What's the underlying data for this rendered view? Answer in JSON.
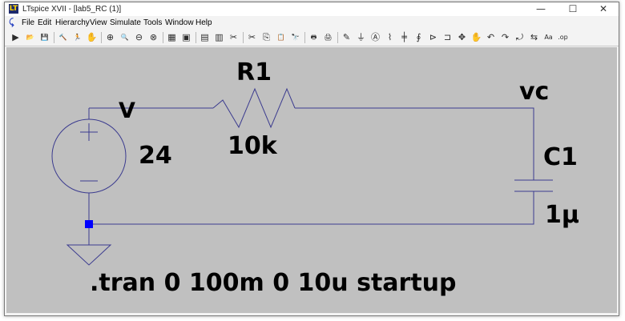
{
  "window": {
    "title": "LTspice XVII - [lab5_RC (1)]",
    "app_icon": "LT",
    "controls": {
      "minimize": "—",
      "maximize": "☐",
      "close": "✕"
    }
  },
  "menu": {
    "icon": "ltspice-arrow-icon",
    "items": [
      {
        "label": "File"
      },
      {
        "label": "Edit"
      },
      {
        "label": "Hierarchy"
      },
      {
        "label": "View"
      },
      {
        "label": "Simulate"
      },
      {
        "label": "Tools"
      },
      {
        "label": "Window"
      },
      {
        "label": "Help"
      }
    ]
  },
  "toolbar": {
    "groups": [
      [
        {
          "name": "run-icon",
          "glyph": "▶"
        },
        {
          "name": "open-icon",
          "glyph": "📂"
        },
        {
          "name": "save-icon",
          "glyph": "💾"
        }
      ],
      [
        {
          "name": "control-panel-icon",
          "glyph": "🔨"
        },
        {
          "name": "run-man-icon",
          "glyph": "🏃"
        },
        {
          "name": "halt-icon",
          "glyph": "✋"
        }
      ],
      [
        {
          "name": "zoom-in-icon",
          "glyph": "⊕"
        },
        {
          "name": "pan-icon",
          "glyph": "🔍"
        },
        {
          "name": "zoom-out-icon",
          "glyph": "⊖"
        },
        {
          "name": "zoom-fit-icon",
          "glyph": "⊗"
        }
      ],
      [
        {
          "name": "autorange-icon",
          "glyph": "▦"
        },
        {
          "name": "schematic-view-icon",
          "glyph": "▣"
        }
      ],
      [
        {
          "name": "tile-horizontal-icon",
          "glyph": "▤"
        },
        {
          "name": "cascade-icon",
          "glyph": "▥"
        },
        {
          "name": "close-all-icon",
          "glyph": "✂"
        }
      ],
      [
        {
          "name": "cut-icon",
          "glyph": "✂"
        },
        {
          "name": "copy-icon",
          "glyph": "⎘"
        },
        {
          "name": "paste-icon",
          "glyph": "📋"
        },
        {
          "name": "find-icon",
          "glyph": "🔭"
        }
      ],
      [
        {
          "name": "print-icon",
          "glyph": "🖶"
        },
        {
          "name": "print-setup-icon",
          "glyph": "🖨"
        }
      ],
      [
        {
          "name": "draw-wire-icon",
          "glyph": "✎"
        },
        {
          "name": "ground-icon",
          "glyph": "⏚"
        },
        {
          "name": "label-net-icon",
          "glyph": "Ⓐ"
        },
        {
          "name": "resistor-icon",
          "glyph": "⌇"
        },
        {
          "name": "capacitor-icon",
          "glyph": "╪"
        },
        {
          "name": "inductor-icon",
          "glyph": "∮"
        },
        {
          "name": "diode-icon",
          "glyph": "⊳"
        },
        {
          "name": "component-icon",
          "glyph": "⊐"
        },
        {
          "name": "move-icon",
          "glyph": "✥"
        },
        {
          "name": "drag-icon",
          "glyph": "✋"
        },
        {
          "name": "undo-icon",
          "glyph": "↶"
        },
        {
          "name": "redo-icon",
          "glyph": "↷"
        },
        {
          "name": "rotate-icon",
          "glyph": "⤾"
        },
        {
          "name": "mirror-icon",
          "glyph": "⇆"
        },
        {
          "name": "text-icon",
          "glyph": "Aa"
        },
        {
          "name": "spice-directive-icon",
          "glyph": ".op"
        }
      ]
    ]
  },
  "schematic": {
    "source": {
      "name": "V",
      "value": "24"
    },
    "resistor": {
      "name": "R1",
      "value": "10k"
    },
    "capacitor": {
      "name": "C1",
      "value": "1µ"
    },
    "net_label": "vc",
    "directive": ".tran 0 100m 0 10u startup",
    "colors": {
      "wire": "#3b3b8f",
      "canvas": "#c0c0c0",
      "junction": "#0000ff"
    }
  }
}
